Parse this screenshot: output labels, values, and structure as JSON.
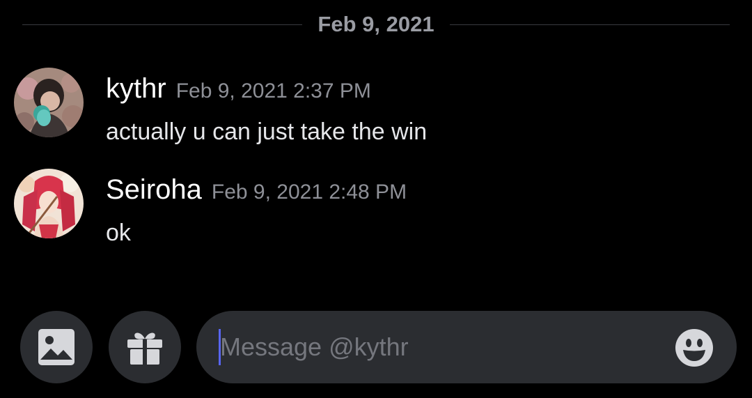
{
  "conversation": {
    "date_divider": "Feb 9, 2021",
    "messages": [
      {
        "author": "kythr",
        "timestamp": "Feb 9, 2021 2:37 PM",
        "text": "actually u can just take the win",
        "avatar": "user-avatar-icon"
      },
      {
        "author": "Seiroha",
        "timestamp": "Feb 9, 2021 2:48 PM",
        "text": "ok",
        "avatar": "user-avatar-icon"
      }
    ]
  },
  "composer": {
    "placeholder": "Message @kythr",
    "buttons": {
      "attach_image": "image-icon",
      "gift": "gift-icon",
      "emoji": "emoji-icon"
    }
  },
  "colors": {
    "background": "#000000",
    "surface": "#2b2d31",
    "text_primary": "#ffffff",
    "text_muted": "#8e9097",
    "accent": "#5865f2"
  }
}
